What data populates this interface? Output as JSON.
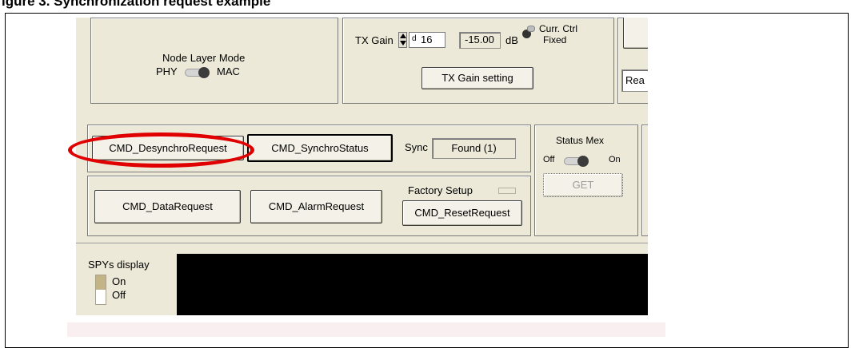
{
  "doc": {
    "heading": "igure 3. Synchronization request example"
  },
  "node_layer": {
    "title": "Node Layer Mode",
    "left": "PHY",
    "right": "MAC"
  },
  "tx_gain": {
    "label": "TX Gain",
    "unit_prefix": "d",
    "value": "16",
    "db_value": "-15.00",
    "db_unit": "dB",
    "curr_ctrl_line1": "Curr. Ctrl",
    "curr_ctrl_line2": "Fixed",
    "setting_button": "TX Gain setting"
  },
  "right_edge": {
    "truncated_button": "Rea"
  },
  "sync_row": {
    "desync_button": "CMD_DesynchroRequest",
    "status_button": "CMD_SynchroStatus",
    "sync_label": "Sync",
    "sync_value": "Found (1)"
  },
  "status_mex": {
    "title": "Status Mex",
    "off": "Off",
    "on": "On",
    "get_button": "GET"
  },
  "data_row": {
    "data_button": "CMD_DataRequest",
    "alarm_button": "CMD_AlarmRequest",
    "factory_label": "Factory Setup",
    "reset_button": "CMD_ResetRequest"
  },
  "spy": {
    "title": "SPYs display",
    "on": "On",
    "off": "Off"
  },
  "colors": {
    "panel_bg": "#ece9d8",
    "annotation": "#e00000",
    "screen": "#000000"
  }
}
